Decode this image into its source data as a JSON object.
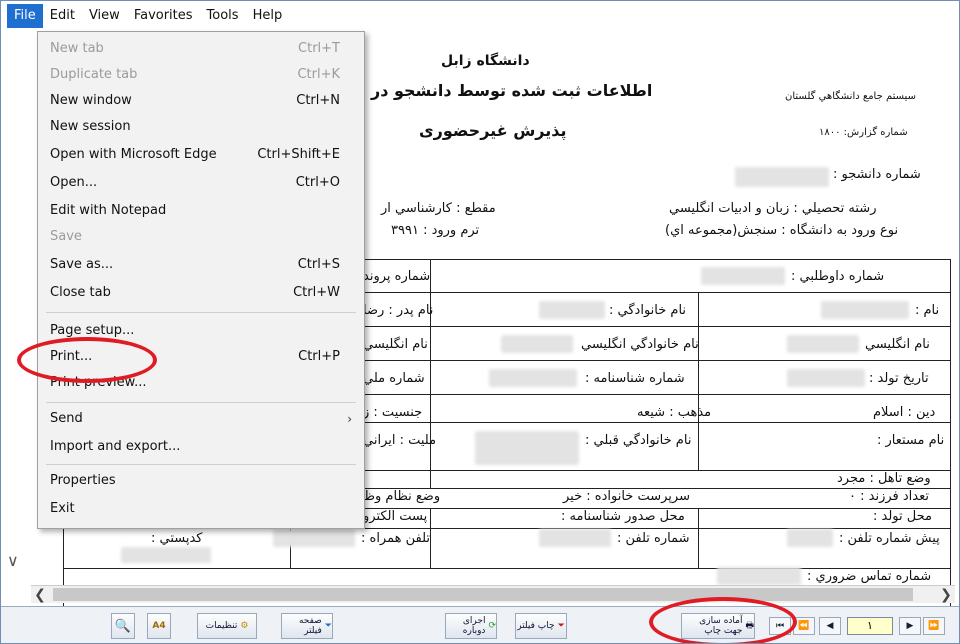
{
  "menubar": {
    "items": [
      "File",
      "Edit",
      "View",
      "Favorites",
      "Tools",
      "Help"
    ]
  },
  "file_menu": {
    "items": [
      {
        "label": "New tab",
        "shortcut": "Ctrl+T",
        "disabled": true
      },
      {
        "label": "Duplicate tab",
        "shortcut": "Ctrl+K",
        "disabled": true
      },
      {
        "label": "New window",
        "shortcut": "Ctrl+N",
        "disabled": false
      },
      {
        "label": "New session",
        "shortcut": "",
        "disabled": false
      },
      {
        "label": "Open with Microsoft Edge",
        "shortcut": "Ctrl+Shift+E",
        "disabled": false
      },
      {
        "label": "Open...",
        "shortcut": "Ctrl+O",
        "disabled": false
      },
      {
        "label": "Edit with Notepad",
        "shortcut": "",
        "disabled": false
      },
      {
        "label": "Save",
        "shortcut": "",
        "disabled": true
      },
      {
        "label": "Save as...",
        "shortcut": "Ctrl+S",
        "disabled": false
      },
      {
        "label": "Close tab",
        "shortcut": "Ctrl+W",
        "disabled": false
      },
      {
        "label": "Page setup...",
        "shortcut": "",
        "disabled": false
      },
      {
        "label": "Print...",
        "shortcut": "Ctrl+P",
        "disabled": false
      },
      {
        "label": "Print preview...",
        "shortcut": "",
        "disabled": false
      },
      {
        "label": "Send",
        "shortcut": "",
        "disabled": false,
        "submenu": true
      },
      {
        "label": "Import and export...",
        "shortcut": "",
        "disabled": false
      },
      {
        "label": "Properties",
        "shortcut": "",
        "disabled": false
      },
      {
        "label": "Exit",
        "shortcut": "",
        "disabled": false
      }
    ]
  },
  "report": {
    "university": "دانشگاه زابل",
    "title": "اطلاعات ثبت شده توسط دانشجو در",
    "subtitle": "پذيرش غيرحضوری",
    "system_name": "سيستم جامع دانشگاهي گلستان",
    "report_number": "شماره گزارش: ۱۸۰۰",
    "student_number": "شماره دانشجو :",
    "field": "رشته تحصيلي : زبان و ادبيات انگليسي",
    "degree": "مقطع : كارشناسي ار",
    "entry_type": "نوع ورود به دانشگاه : سنجش(مجموعه اي)",
    "entry_term": "ترم ورود : ۳۹۹۱",
    "cells": {
      "r1c1": "شماره داوطلبي :",
      "r1c3": "شماره پروند",
      "r2c1": "نام :",
      "r2c2": "نام خانوادگي :",
      "r2c3": "نام پدر : رضا",
      "r3c1": "نام انگليسي",
      "r3c2": "نام خانوادگي انگليسي",
      "r3c3": "نام انگليسي",
      "r4c1": "تاريخ تولد :",
      "r4c2": "شماره شناسنامه :",
      "r4c3": "شماره ملي",
      "r5c1": "دين : اسلام",
      "r5c2": "مذهب : شيعه",
      "r5c3": "جنسيت : ز",
      "r6c1": "نام مستعار :",
      "r6c2": "نام خانوادگي قبلي :",
      "r6c3": "مليت : ايراني",
      "r7c1": "وضع تاهل : مجرد",
      "r8c1": "تعداد فرزند : ۰",
      "r8c2": "سرپرست خانواده : خير",
      "r8c3": "وضع نظام وظ",
      "r9c1": "محل تولد :",
      "r9c2": "محل صدور شناسنامه :",
      "r9c3": "پست الكترو",
      "r10c1": "پيش شماره تلفن :",
      "r10c2": "شماره تلفن :",
      "r10c3": "تلفن همراه :",
      "r10c4": "كدپستي :",
      "r11c1": "شماره تماس ضروري :"
    }
  },
  "toolbar": {
    "settings": "تنظيمات",
    "filter": "صفحه فيلتر",
    "rerun": "اجرای دوباره",
    "print_filter": "چاپ فيلتر",
    "prepare_print": "آماده سازی جهت چاپ",
    "page": "۱",
    "a4": "A4"
  },
  "highlight_color": "#e01b24",
  "accent_color": "#1f6fd1"
}
